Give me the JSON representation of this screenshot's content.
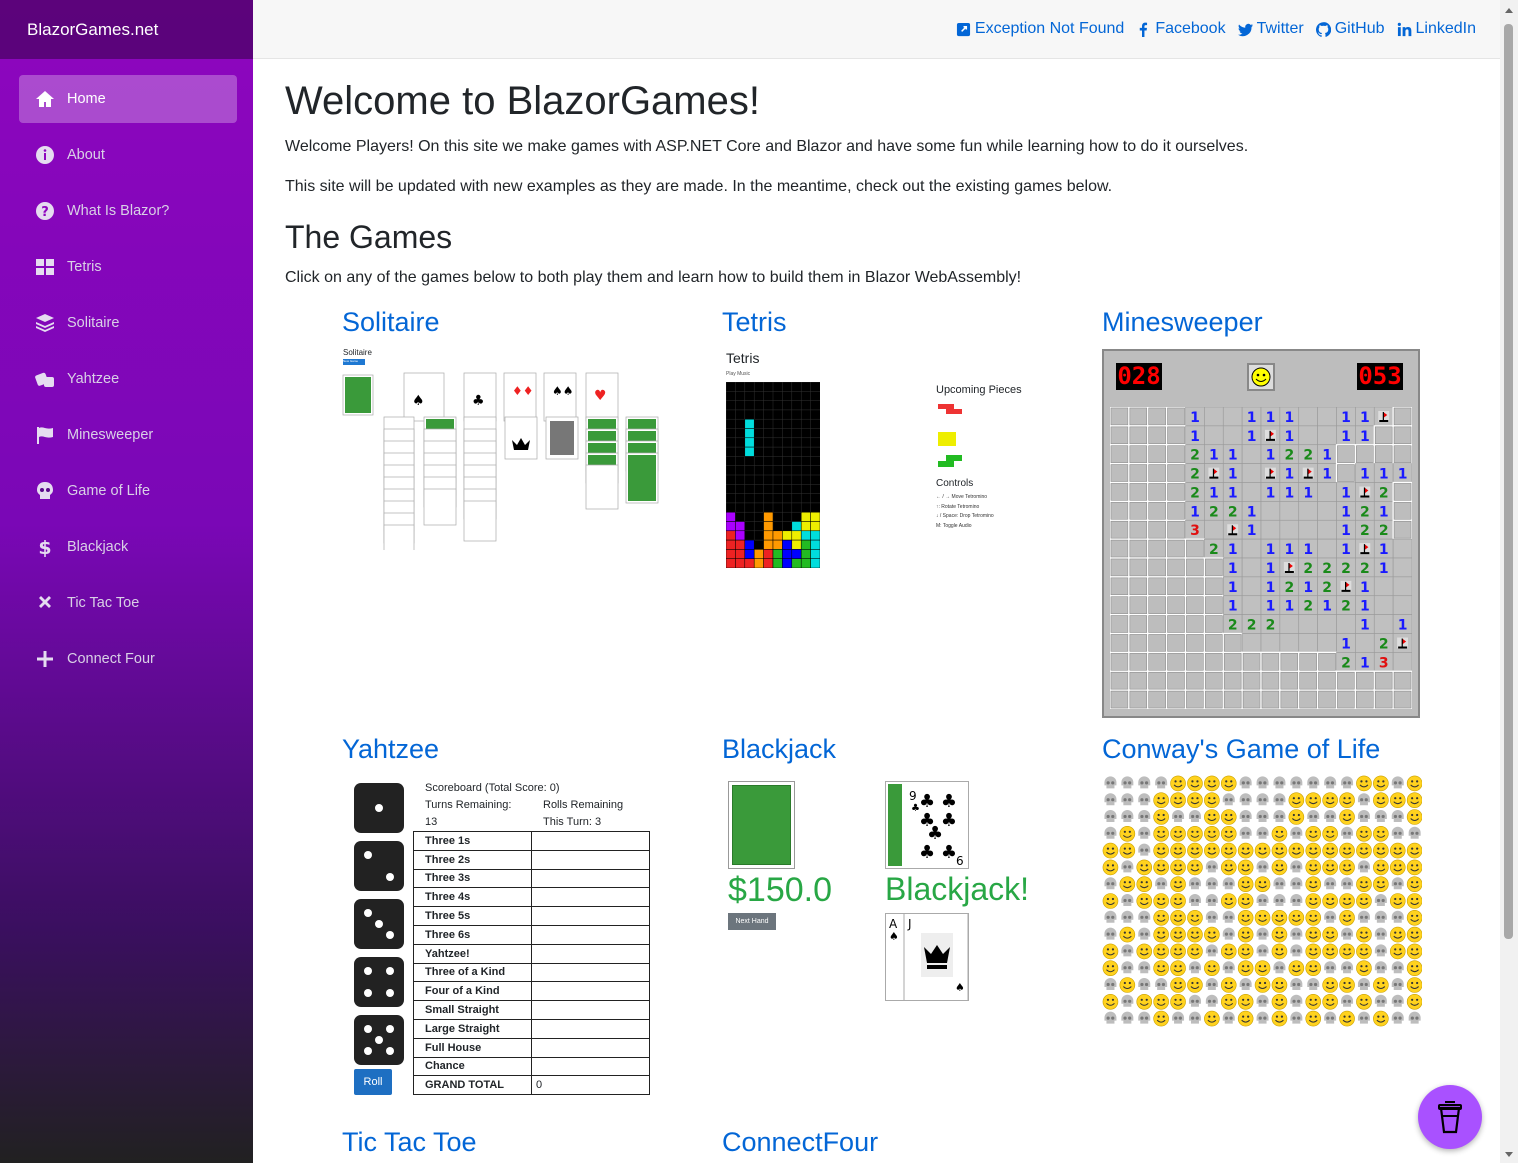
{
  "brand": "BlazorGames.net",
  "nav": [
    {
      "label": "Home",
      "icon": "home-icon",
      "active": true
    },
    {
      "label": "About",
      "icon": "info-icon"
    },
    {
      "label": "What Is Blazor?",
      "icon": "question-icon"
    },
    {
      "label": "Tetris",
      "icon": "grid-icon"
    },
    {
      "label": "Solitaire",
      "icon": "layers-icon"
    },
    {
      "label": "Yahtzee",
      "icon": "dice-icon"
    },
    {
      "label": "Minesweeper",
      "icon": "flag-icon"
    },
    {
      "label": "Game of Life",
      "icon": "skull-icon"
    },
    {
      "label": "Blackjack",
      "icon": "dollar-icon"
    },
    {
      "label": "Tic Tac Toe",
      "icon": "x-icon"
    },
    {
      "label": "Connect Four",
      "icon": "plus-icon"
    }
  ],
  "toplinks": [
    {
      "label": "Exception Not Found",
      "icon": "external-link-icon"
    },
    {
      "label": "Facebook",
      "icon": "facebook-icon"
    },
    {
      "label": "Twitter",
      "icon": "twitter-icon"
    },
    {
      "label": "GitHub",
      "icon": "github-icon"
    },
    {
      "label": "LinkedIn",
      "icon": "linkedin-icon"
    }
  ],
  "main": {
    "heading": "Welcome to BlazorGames!",
    "intro": "Welcome Players! On this site we make games with ASP.NET Core and Blazor and have some fun while learning how to do it ourselves.",
    "update": "This site will be updated with new examples as they are made. In the meantime, check out the existing games below.",
    "games_heading": "The Games",
    "games_intro": "Click on any of the games below to both play them and learn how to build them in Blazor WebAssembly!"
  },
  "games": {
    "solitaire": {
      "title": "Solitaire",
      "thumb_title": "Solitaire",
      "thumb_button": "New Game"
    },
    "tetris": {
      "title": "Tetris",
      "thumb_title": "Tetris",
      "play_music": "Play Music",
      "upcoming": "Upcoming Pieces",
      "controls": "Controls",
      "control_lines": [
        "← / → Move Tetromino",
        "↑: Rotate Tetromino",
        "↓ / Space: Drop Tetromino",
        "M: Toggle Audio"
      ]
    },
    "minesweeper": {
      "title": "Minesweeper",
      "mines": "028",
      "timer": "053"
    },
    "yahtzee": {
      "title": "Yahtzee",
      "scoreboard": "Scoreboard (Total Score: 0)",
      "turns_label": "Turns Remaining:",
      "turns_value": "13",
      "rolls_label": "Rolls Remaining",
      "rolls_value": "This Turn: 3",
      "rows": [
        "Three 1s",
        "Three 2s",
        "Three 3s",
        "Three 4s",
        "Three 5s",
        "Three 6s",
        "Yahtzee!",
        "Three of a Kind",
        "Four of a Kind",
        "Small Straight",
        "Large Straight",
        "Full House",
        "Chance",
        "GRAND TOTAL"
      ],
      "grand_total": "0",
      "roll_button": "Roll",
      "dice": [
        1,
        2,
        3,
        4,
        5
      ]
    },
    "blackjack": {
      "title": "Blackjack",
      "money": "$150.0",
      "next_hand": "Next Hand",
      "result": "Blackjack!"
    },
    "life": {
      "title": "Conway's Game of Life"
    },
    "tictactoe": {
      "title": "Tic Tac Toe"
    },
    "connectfour": {
      "title": "ConnectFour"
    }
  },
  "colors": {
    "link": "#0366d6",
    "sidebar_top": "#8e06be",
    "green": "#28a745"
  }
}
